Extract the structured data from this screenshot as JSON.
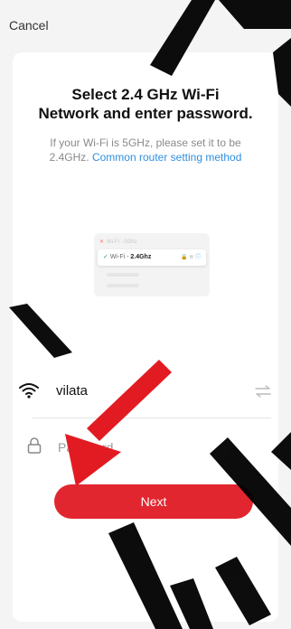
{
  "header": {
    "cancel_label": "Cancel"
  },
  "card": {
    "title_line1": "Select 2.4 GHz Wi-Fi",
    "title_line2": "Network and enter password.",
    "subtitle_text": "If your Wi-Fi is 5GHz, please set it to be 2.4GHz. ",
    "subtitle_link": "Common router setting method"
  },
  "preview": {
    "row1_label": "Wi-Fi - 5Ghz",
    "selected_prefix": "Wi-Fi - ",
    "selected_band": "2.4Ghz"
  },
  "wifi": {
    "ssid": "vilata",
    "wifi_icon": "wifi-icon",
    "switch_icon": "swap-icon"
  },
  "password": {
    "placeholder": "Password",
    "lock_icon": "lock-icon"
  },
  "actions": {
    "next_label": "Next"
  },
  "colors": {
    "accent": "#e2262f",
    "link": "#2f8fe0",
    "watermark": "#000000"
  }
}
